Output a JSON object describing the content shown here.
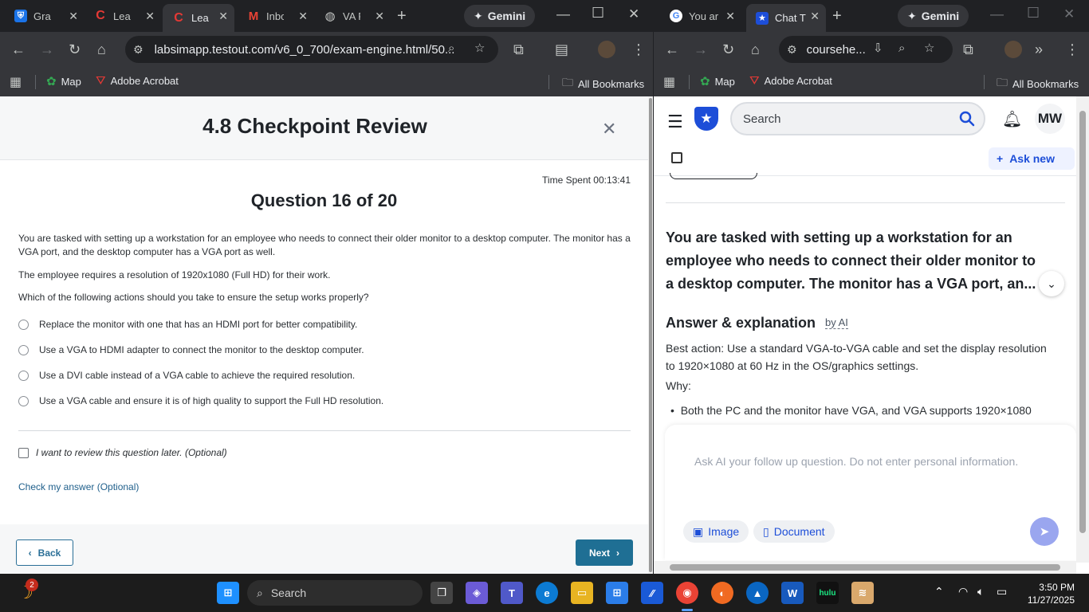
{
  "left_browser": {
    "tabs": [
      {
        "label": "Grad",
        "color": "#1a73e8"
      },
      {
        "label": "Lear",
        "color": "#c62828"
      },
      {
        "label": "Lear",
        "color": "#c62828"
      },
      {
        "label": "Inbo",
        "color": "#ea4335"
      },
      {
        "label": "VA F",
        "color": "#8ab4f8"
      }
    ],
    "gemini_label": "Gemini",
    "url": "labsimapp.testout.com/v6_0_700/exam-engine.html/50...",
    "bookmarks": [
      "Map",
      "Adobe Acrobat"
    ],
    "all_bookmarks": "All Bookmarks"
  },
  "exam": {
    "title": "4.8 Checkpoint Review",
    "time_spent": "Time Spent 00:13:41",
    "question_number": "Question 16 of 20",
    "paragraph1": "You are tasked with setting up a workstation for an employee who needs to connect their older monitor to a desktop computer. The monitor has a VGA port, and the desktop computer has a VGA port as well.",
    "paragraph2": "The employee requires a resolution of 1920x1080 (Full HD) for their work.",
    "paragraph3": "Which of the following actions should you take to ensure the setup works properly?",
    "options": [
      "Replace the monitor with one that has an HDMI port for better compatibility.",
      "Use a VGA to HDMI adapter to connect the monitor to the desktop computer.",
      "Use a DVI cable instead of a VGA cable to achieve the required resolution.",
      "Use a VGA cable and ensure it is of high quality to support the Full HD resolution."
    ],
    "review_label": "I want to review this question later. (Optional)",
    "check_answer": "Check my answer (Optional)",
    "back": "Back",
    "next": "Next"
  },
  "right_browser": {
    "tabs": [
      {
        "label": "You ar",
        "color": "#4285f4"
      },
      {
        "label": "Chat T",
        "color": "#1d4ed8"
      }
    ],
    "gemini_label": "Gemini",
    "url": "coursehe...",
    "bookmarks": [
      "Map",
      "Adobe Acrobat"
    ],
    "all_bookmarks": "All Bookmarks"
  },
  "chat": {
    "search_placeholder": "Search",
    "avatar_initials": "MW",
    "ask_new": "Ask new",
    "question": "You are tasked with setting up a workstation for an employee who needs to connect their older monitor to a desktop computer. The monitor has a VGA port, an...",
    "answer_heading": "Answer & explanation",
    "by_ai": "by AI",
    "best_action": "Best action: Use a standard VGA-to-VGA cable and set the display resolution to 1920×1080 at 60 Hz in the OS/graphics settings.",
    "why": "Why:",
    "bullet1": "Both the PC and the monitor have VGA, and VGA supports 1920×1080",
    "composer_placeholder": "Ask AI your follow up question. Do not enter personal information.",
    "image_button": "Image",
    "document_button": "Document"
  },
  "taskbar": {
    "notification_count": "2",
    "search_label": "Search",
    "time": "3:50 PM",
    "date": "11/27/2025",
    "hulu_label": "hulu"
  }
}
